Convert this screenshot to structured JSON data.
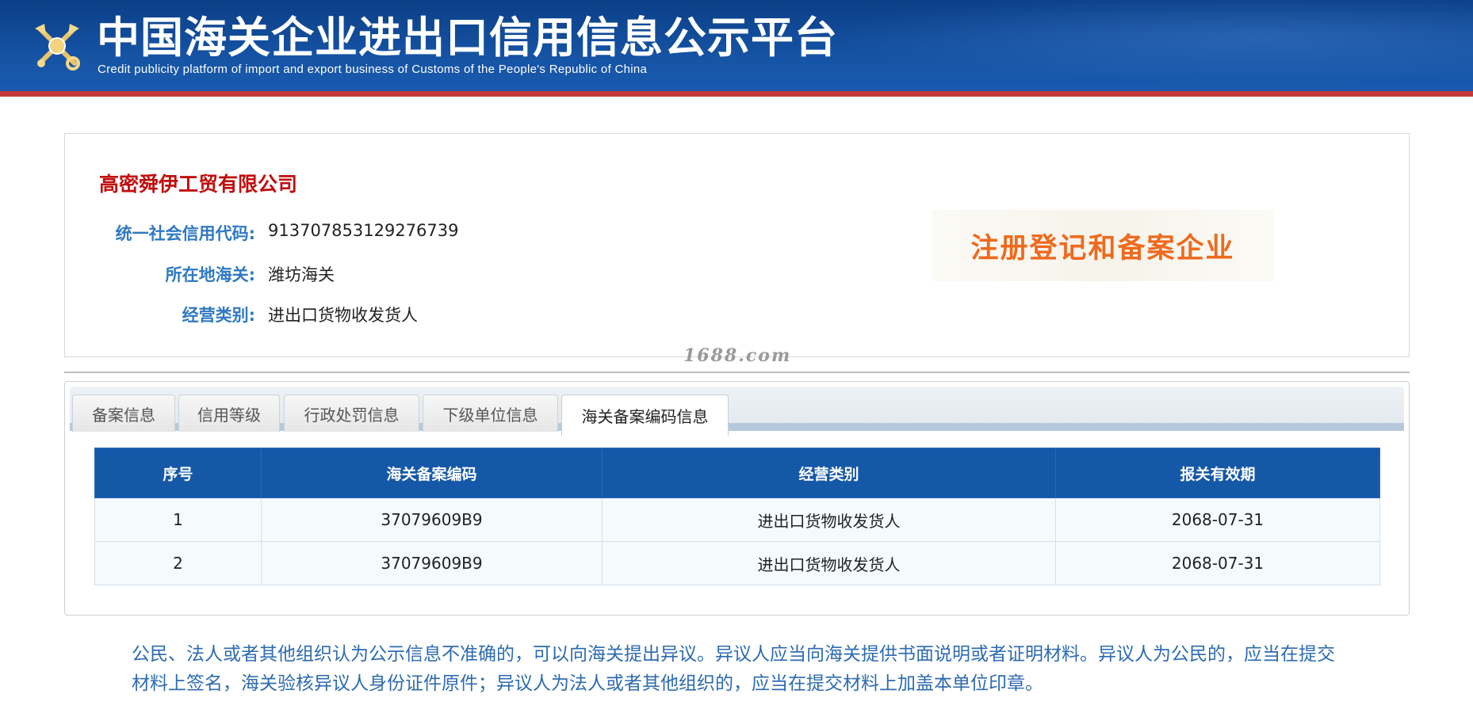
{
  "header": {
    "title_cn": "中国海关企业进出口信用信息公示平台",
    "title_en": "Credit publicity platform of import and export business of Customs of the People's Republic of China",
    "logo_icon": "customs-emblem-icon"
  },
  "company": {
    "name": "高密舜伊工贸有限公司",
    "fields": [
      {
        "label": "统一社会信用代码:",
        "value": "913707853129276739"
      },
      {
        "label": "所在地海关:",
        "value": "潍坊海关"
      },
      {
        "label": "经营类别:",
        "value": "进出口货物收发货人"
      }
    ],
    "stamp": "注册登记和备案企业"
  },
  "watermark": "1688.com",
  "tabs": [
    {
      "label": "备案信息",
      "active": false
    },
    {
      "label": "信用等级",
      "active": false
    },
    {
      "label": "行政处罚信息",
      "active": false
    },
    {
      "label": "下级单位信息",
      "active": false
    },
    {
      "label": "海关备案编码信息",
      "active": true
    }
  ],
  "table": {
    "headers": [
      "序号",
      "海关备案编码",
      "经营类别",
      "报关有效期"
    ],
    "rows": [
      [
        "1",
        "37079609B9",
        "进出口货物收发货人",
        "2068-07-31"
      ],
      [
        "2",
        "37079609B9",
        "进出口货物收发货人",
        "2068-07-31"
      ]
    ]
  },
  "notice": "公民、法人或者其他组织认为公示信息不准确的，可以向海关提出异议。异议人应当向海关提供书面说明或者证明材料。异议人为公民的，应当在提交材料上签名，海关验核异议人身份证件原件；异议人为法人或者其他组织的，应当在提交材料上加盖本单位印章。",
  "colors": {
    "header_blue": "#1552a3",
    "header_red_line": "#c43a3a",
    "company_name_red": "#c20e0e",
    "label_blue": "#2f79c2",
    "table_header_blue": "#1558a8",
    "stamp_orange": "#ee6a1d",
    "notice_blue": "#2d6bb0"
  }
}
